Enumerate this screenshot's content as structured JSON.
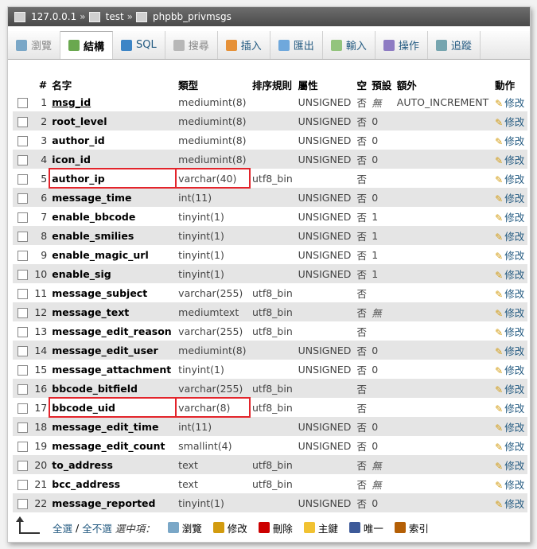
{
  "breadcrumb": {
    "server": "127.0.0.1",
    "db": "test",
    "table": "phpbb_privmsgs",
    "sep": "»"
  },
  "tabs": [
    {
      "label": "瀏覽",
      "state": "disabled",
      "icon": "browse-icon"
    },
    {
      "label": "結構",
      "state": "active",
      "icon": "structure-icon"
    },
    {
      "label": "SQL",
      "state": "normal",
      "icon": "sql-icon"
    },
    {
      "label": "搜尋",
      "state": "disabled",
      "icon": "search-icon"
    },
    {
      "label": "插入",
      "state": "normal",
      "icon": "insert-icon"
    },
    {
      "label": "匯出",
      "state": "normal",
      "icon": "export-icon"
    },
    {
      "label": "輸入",
      "state": "normal",
      "icon": "import-icon"
    },
    {
      "label": "操作",
      "state": "normal",
      "icon": "operations-icon"
    },
    {
      "label": "追蹤",
      "state": "normal",
      "icon": "tracking-icon"
    }
  ],
  "columns": [
    "#",
    "名字",
    "類型",
    "排序規則",
    "屬性",
    "空",
    "預設",
    "額外",
    "動作"
  ],
  "edit_label": "修改",
  "rows": [
    {
      "n": "1",
      "name": "msg_id",
      "type": "mediumint(8)",
      "collation": "",
      "attr": "UNSIGNED",
      "null": "否",
      "default": "無",
      "extra": "AUTO_INCREMENT"
    },
    {
      "n": "2",
      "name": "root_level",
      "type": "mediumint(8)",
      "collation": "",
      "attr": "UNSIGNED",
      "null": "否",
      "default": "0",
      "extra": ""
    },
    {
      "n": "3",
      "name": "author_id",
      "type": "mediumint(8)",
      "collation": "",
      "attr": "UNSIGNED",
      "null": "否",
      "default": "0",
      "extra": ""
    },
    {
      "n": "4",
      "name": "icon_id",
      "type": "mediumint(8)",
      "collation": "",
      "attr": "UNSIGNED",
      "null": "否",
      "default": "0",
      "extra": ""
    },
    {
      "n": "5",
      "name": "author_ip",
      "type": "varchar(40)",
      "collation": "utf8_bin",
      "attr": "",
      "null": "否",
      "default": "",
      "extra": ""
    },
    {
      "n": "6",
      "name": "message_time",
      "type": "int(11)",
      "collation": "",
      "attr": "UNSIGNED",
      "null": "否",
      "default": "0",
      "extra": ""
    },
    {
      "n": "7",
      "name": "enable_bbcode",
      "type": "tinyint(1)",
      "collation": "",
      "attr": "UNSIGNED",
      "null": "否",
      "default": "1",
      "extra": ""
    },
    {
      "n": "8",
      "name": "enable_smilies",
      "type": "tinyint(1)",
      "collation": "",
      "attr": "UNSIGNED",
      "null": "否",
      "default": "1",
      "extra": ""
    },
    {
      "n": "9",
      "name": "enable_magic_url",
      "type": "tinyint(1)",
      "collation": "",
      "attr": "UNSIGNED",
      "null": "否",
      "default": "1",
      "extra": ""
    },
    {
      "n": "10",
      "name": "enable_sig",
      "type": "tinyint(1)",
      "collation": "",
      "attr": "UNSIGNED",
      "null": "否",
      "default": "1",
      "extra": ""
    },
    {
      "n": "11",
      "name": "message_subject",
      "type": "varchar(255)",
      "collation": "utf8_bin",
      "attr": "",
      "null": "否",
      "default": "",
      "extra": ""
    },
    {
      "n": "12",
      "name": "message_text",
      "type": "mediumtext",
      "collation": "utf8_bin",
      "attr": "",
      "null": "否",
      "default": "無",
      "extra": ""
    },
    {
      "n": "13",
      "name": "message_edit_reason",
      "type": "varchar(255)",
      "collation": "utf8_bin",
      "attr": "",
      "null": "否",
      "default": "",
      "extra": ""
    },
    {
      "n": "14",
      "name": "message_edit_user",
      "type": "mediumint(8)",
      "collation": "",
      "attr": "UNSIGNED",
      "null": "否",
      "default": "0",
      "extra": ""
    },
    {
      "n": "15",
      "name": "message_attachment",
      "type": "tinyint(1)",
      "collation": "",
      "attr": "UNSIGNED",
      "null": "否",
      "default": "0",
      "extra": ""
    },
    {
      "n": "16",
      "name": "bbcode_bitfield",
      "type": "varchar(255)",
      "collation": "utf8_bin",
      "attr": "",
      "null": "否",
      "default": "",
      "extra": ""
    },
    {
      "n": "17",
      "name": "bbcode_uid",
      "type": "varchar(8)",
      "collation": "utf8_bin",
      "attr": "",
      "null": "否",
      "default": "",
      "extra": ""
    },
    {
      "n": "18",
      "name": "message_edit_time",
      "type": "int(11)",
      "collation": "",
      "attr": "UNSIGNED",
      "null": "否",
      "default": "0",
      "extra": ""
    },
    {
      "n": "19",
      "name": "message_edit_count",
      "type": "smallint(4)",
      "collation": "",
      "attr": "UNSIGNED",
      "null": "否",
      "default": "0",
      "extra": ""
    },
    {
      "n": "20",
      "name": "to_address",
      "type": "text",
      "collation": "utf8_bin",
      "attr": "",
      "null": "否",
      "default": "無",
      "extra": ""
    },
    {
      "n": "21",
      "name": "bcc_address",
      "type": "text",
      "collation": "utf8_bin",
      "attr": "",
      "null": "否",
      "default": "無",
      "extra": ""
    },
    {
      "n": "22",
      "name": "message_reported",
      "type": "tinyint(1)",
      "collation": "",
      "attr": "UNSIGNED",
      "null": "否",
      "default": "0",
      "extra": ""
    }
  ],
  "highlighted_rows": [
    "5",
    "17"
  ],
  "footer": {
    "check_all": "全選",
    "divider": "/",
    "uncheck_all": "全不選",
    "with_selected": "選中項：",
    "actions": [
      {
        "label": "瀏覽",
        "icon": "browse-icon"
      },
      {
        "label": "修改",
        "icon": "pencil-icon"
      },
      {
        "label": "刪除",
        "icon": "delete-icon"
      },
      {
        "label": "主鍵",
        "icon": "primary-key-icon"
      },
      {
        "label": "唯一",
        "icon": "unique-icon"
      },
      {
        "label": "索引",
        "icon": "index-icon"
      }
    ]
  },
  "colors": {
    "link": "#235a81",
    "highlight": "#e3242b",
    "row_alt": "#e5e5e5"
  }
}
